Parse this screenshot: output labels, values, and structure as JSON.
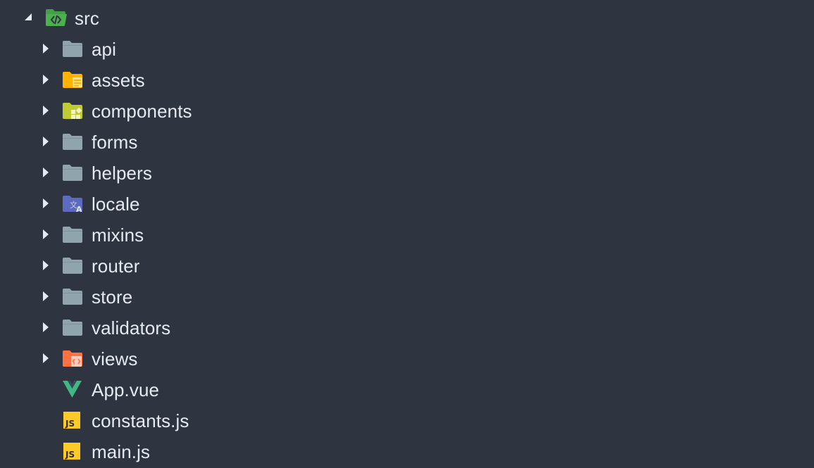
{
  "explorer": {
    "root": {
      "label": "src",
      "icon": "folder-src-open-icon",
      "expanded": true,
      "color": "#4caf50"
    },
    "items": [
      {
        "label": "api",
        "kind": "folder",
        "icon": "folder-icon",
        "color": "#90a4ae"
      },
      {
        "label": "assets",
        "kind": "folder",
        "icon": "folder-assets-icon",
        "color": "#ffb300"
      },
      {
        "label": "components",
        "kind": "folder",
        "icon": "folder-components-icon",
        "color": "#c0ca33"
      },
      {
        "label": "forms",
        "kind": "folder",
        "icon": "folder-icon",
        "color": "#90a4ae"
      },
      {
        "label": "helpers",
        "kind": "folder",
        "icon": "folder-icon",
        "color": "#90a4ae"
      },
      {
        "label": "locale",
        "kind": "folder",
        "icon": "folder-locale-icon",
        "color": "#5c6bc0"
      },
      {
        "label": "mixins",
        "kind": "folder",
        "icon": "folder-icon",
        "color": "#90a4ae"
      },
      {
        "label": "router",
        "kind": "folder",
        "icon": "folder-icon",
        "color": "#90a4ae"
      },
      {
        "label": "store",
        "kind": "folder",
        "icon": "folder-icon",
        "color": "#90a4ae"
      },
      {
        "label": "validators",
        "kind": "folder",
        "icon": "folder-icon",
        "color": "#90a4ae"
      },
      {
        "label": "views",
        "kind": "folder",
        "icon": "folder-views-icon",
        "color": "#ff7043"
      },
      {
        "label": "App.vue",
        "kind": "file",
        "icon": "vue-icon",
        "color": "#41b883"
      },
      {
        "label": "constants.js",
        "kind": "file",
        "icon": "javascript-icon",
        "color": "#ffca28"
      },
      {
        "label": "main.js",
        "kind": "file",
        "icon": "javascript-icon",
        "color": "#ffca28"
      }
    ]
  },
  "colors": {
    "background": "#2e3440",
    "text": "#e6e9ef",
    "twisty": "#e5e9f0"
  }
}
